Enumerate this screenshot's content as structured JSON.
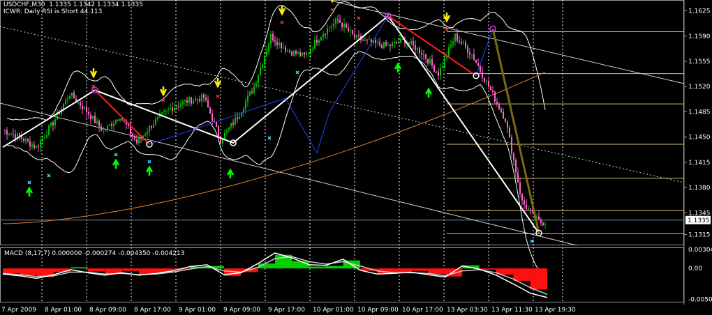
{
  "chart_data": {
    "type": "candlestick",
    "header": {
      "symbol_line": "USDCHF,M30  1.1335 1.1342 1.1334 1.1335",
      "indicator_line": "ICWR: Daily RSI is Short 44.113"
    },
    "price_axis": {
      "ticks": [
        "1.1625",
        "1.1590",
        "1.1555",
        "1.1520",
        "1.1485",
        "1.1450",
        "1.1415",
        "1.1380",
        "1.1345",
        "1.1315"
      ],
      "tick_values": [
        1.1625,
        1.159,
        1.1555,
        1.152,
        1.1485,
        1.145,
        1.1415,
        1.138,
        1.1345,
        1.1315
      ],
      "current_price": "1.1335",
      "ylim": [
        1.13,
        1.164
      ]
    },
    "time_axis": {
      "labels": [
        "7 Apr 2009",
        "8 Apr 01:00",
        "8 Apr 09:00",
        "8 Apr 17:00",
        "9 Apr 01:00",
        "9 Apr 09:00",
        "9 Apr 17:00",
        "10 Apr 01:00",
        "10 Apr 09:00",
        "10 Apr 17:00",
        "13 Apr 03:30",
        "13 Apr 11:30",
        "13 Apr 19:30"
      ]
    },
    "price_series": {
      "name": "",
      "bars_index": [
        0,
        8,
        16,
        24,
        32,
        40,
        48,
        56,
        64,
        72,
        80,
        88,
        96,
        104,
        112,
        120,
        128,
        136,
        144,
        152,
        160,
        168,
        176,
        184,
        192,
        200,
        208,
        216,
        224,
        232,
        240,
        248,
        256
      ],
      "close": [
        1.146,
        1.145,
        1.1436,
        1.147,
        1.151,
        1.1486,
        1.1458,
        1.148,
        1.1442,
        1.147,
        1.149,
        1.15,
        1.1505,
        1.1446,
        1.1478,
        1.152,
        1.159,
        1.157,
        1.1562,
        1.1592,
        1.1612,
        1.1588,
        1.158,
        1.1576,
        1.1584,
        1.1568,
        1.1538,
        1.159,
        1.1565,
        1.152,
        1.1475,
        1.136,
        1.1332
      ]
    },
    "zigzag_points": {
      "x": [
        0,
        44,
        70,
        110,
        135,
        150,
        156,
        184,
        192,
        200,
        210,
        226,
        234,
        246,
        256
      ],
      "y": [
        1.1436,
        1.1515,
        1.144,
        1.1442,
        1.1504,
        1.1428,
        1.1485,
        1.1618,
        1.159,
        1.158,
        1.158,
        1.1535,
        1.16,
        1.15,
        1.1317
      ]
    },
    "macd": {
      "label": "MACD  (8,17,7) 0.000000 -0.000274 -0.004350 -0.004213",
      "ticks": [
        "0.003048",
        "0.00",
        "-0.00500"
      ],
      "tick_values": [
        0.003048,
        0.0,
        -0.005
      ],
      "ylim": [
        -0.0055,
        0.0034
      ],
      "hist": [
        -0.0008,
        -0.0011,
        -0.0014,
        -0.0006,
        0.0002,
        -0.0005,
        -0.0009,
        -0.0004,
        -0.001,
        -0.0006,
        -0.0002,
        0.0003,
        0.0004,
        -0.0012,
        -0.0006,
        0.0008,
        0.0022,
        0.0012,
        0.0003,
        0.0004,
        0.0013,
        -0.0004,
        -0.0008,
        -0.0006,
        -0.0004,
        -0.0009,
        -0.0013,
        0.0005,
        -0.0002,
        -0.001,
        -0.002,
        -0.0034,
        -0.0043
      ],
      "line": [
        -0.0009,
        -0.0012,
        -0.0016,
        -0.001,
        -0.0002,
        -0.0007,
        -0.0011,
        -0.0007,
        -0.0011,
        -0.0008,
        -0.0004,
        0.0003,
        0.0006,
        -0.001,
        -0.0007,
        0.0008,
        0.0025,
        0.0017,
        0.0006,
        0.0005,
        0.0015,
        -0.0003,
        -0.0009,
        -0.0008,
        -0.0006,
        -0.001,
        -0.0014,
        0.0004,
        -0.0001,
        -0.0011,
        -0.0025,
        -0.004,
        -0.0047
      ],
      "signal": [
        -0.0008,
        -0.001,
        -0.0013,
        -0.0012,
        -0.0006,
        -0.0006,
        -0.0009,
        -0.0008,
        -0.001,
        -0.0009,
        -0.0006,
        -0.0001,
        0.0003,
        -0.0004,
        -0.0006,
        0.0002,
        0.0016,
        0.0019,
        0.0011,
        0.0007,
        0.0011,
        0.0004,
        -0.0004,
        -0.0007,
        -0.0007,
        -0.0008,
        -0.0012,
        -0.0004,
        -0.0002,
        -0.0007,
        -0.0017,
        -0.0031,
        -0.0042
      ]
    },
    "colors": {
      "background": "#000000",
      "candle_up": "#00c000",
      "candle_down": "#ff66cc",
      "bollinger": "#ffffff",
      "ma_curve": "#e08030",
      "fib_lines": "#d8c070",
      "zigzag_blue": "#2244ff",
      "zigzag_red": "#ff2020",
      "trend_white": "#ffffff",
      "trend_olive": "#7a6a10",
      "arrow_up": "#00ff00",
      "arrow_down": "#ffee00",
      "macd_pos": "#00d000",
      "macd_neg": "#ff1010"
    }
  }
}
